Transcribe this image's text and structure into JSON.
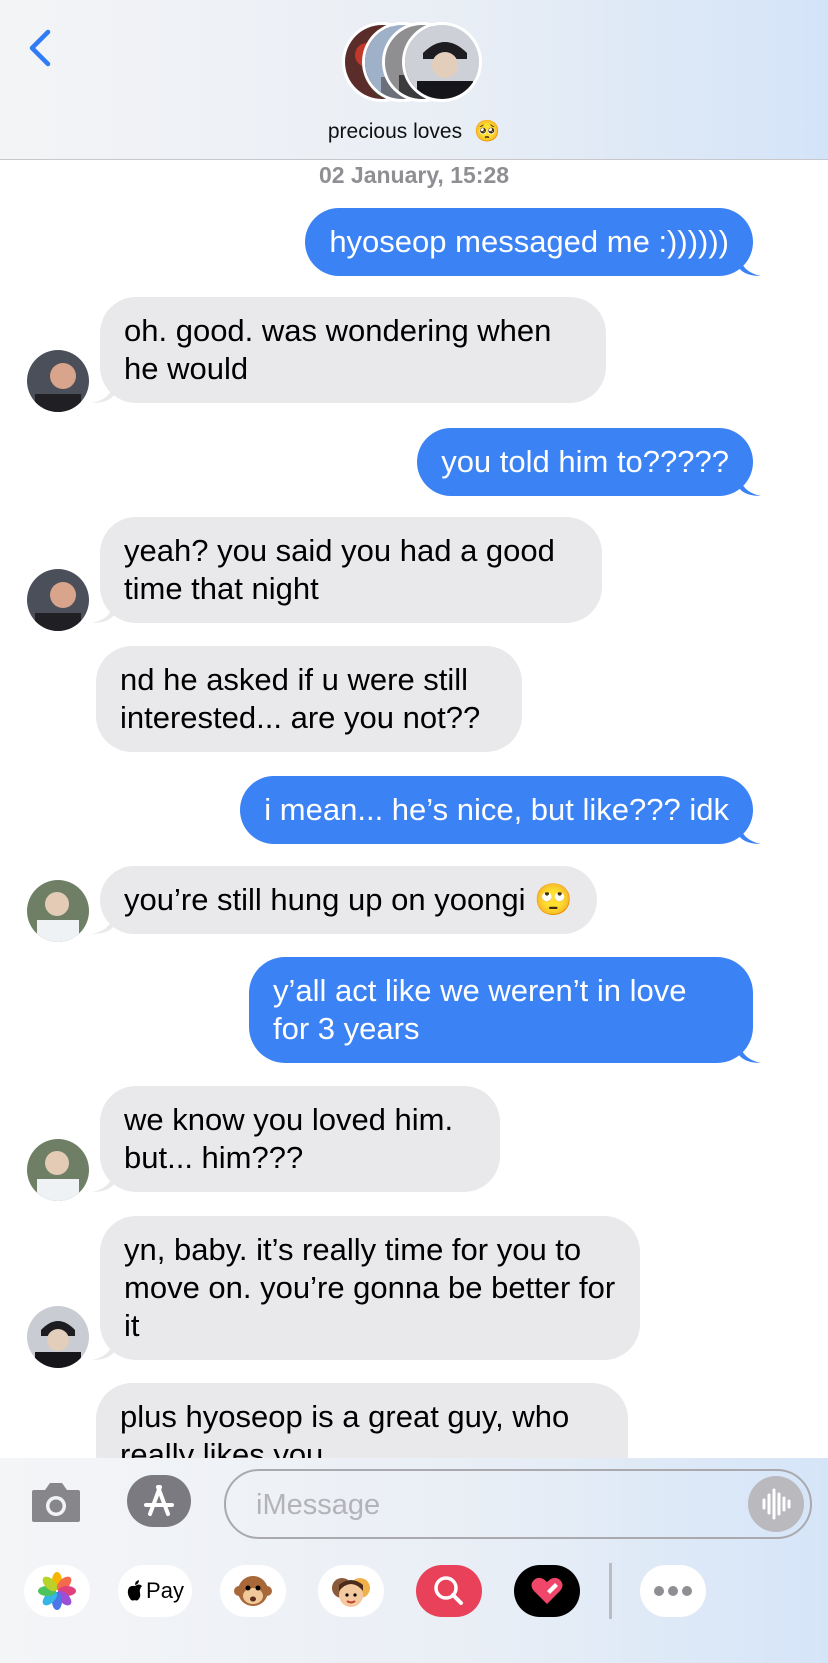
{
  "header": {
    "group_name": "precious loves",
    "back_icon": "chevron-left-icon",
    "group_emoji": "🥺"
  },
  "thread": {
    "timestamp": "02 January, 15:28",
    "messages": [
      {
        "from": "me",
        "text": "hyoseop messaged me :))))))"
      },
      {
        "from": "other",
        "text": "oh. good. was wondering when he would"
      },
      {
        "from": "me",
        "text": "you told him to?????"
      },
      {
        "from": "other",
        "text": "yeah? you said you had a good time that night"
      },
      {
        "from": "other",
        "text": "nd he asked if u were still interested... are you not??"
      },
      {
        "from": "me",
        "text": "i mean... he’s nice, but like??? idk"
      },
      {
        "from": "other",
        "text": "you’re still hung up on yoongi 🙄"
      },
      {
        "from": "me",
        "text": "y’all act like we weren’t in love for 3 years"
      },
      {
        "from": "other",
        "text": "we know you loved him. but... him???"
      },
      {
        "from": "other",
        "text": "yn, baby. it’s really time for you to move on. you’re gonna be better for it"
      },
      {
        "from": "other",
        "text": "plus hyoseop is a great guy, who really likes you"
      }
    ]
  },
  "composer": {
    "placeholder": "iMessage",
    "pay_label": "Pay",
    "camera_icon": "camera-icon",
    "appstore_icon": "app-store-icon",
    "audio_icon": "audio-waveform-icon"
  },
  "app_drawer": [
    {
      "name": "photos-app-icon"
    },
    {
      "name": "apple-pay-app-icon"
    },
    {
      "name": "animoji-app-icon"
    },
    {
      "name": "memoji-stickers-app-icon"
    },
    {
      "name": "image-search-app-icon"
    },
    {
      "name": "digital-touch-app-icon"
    },
    {
      "name": "more-apps-icon"
    }
  ],
  "colors": {
    "outgoing_bubble": "#3b82f5",
    "incoming_bubble": "#e9e9eb",
    "accent": "#2f7cf6"
  }
}
